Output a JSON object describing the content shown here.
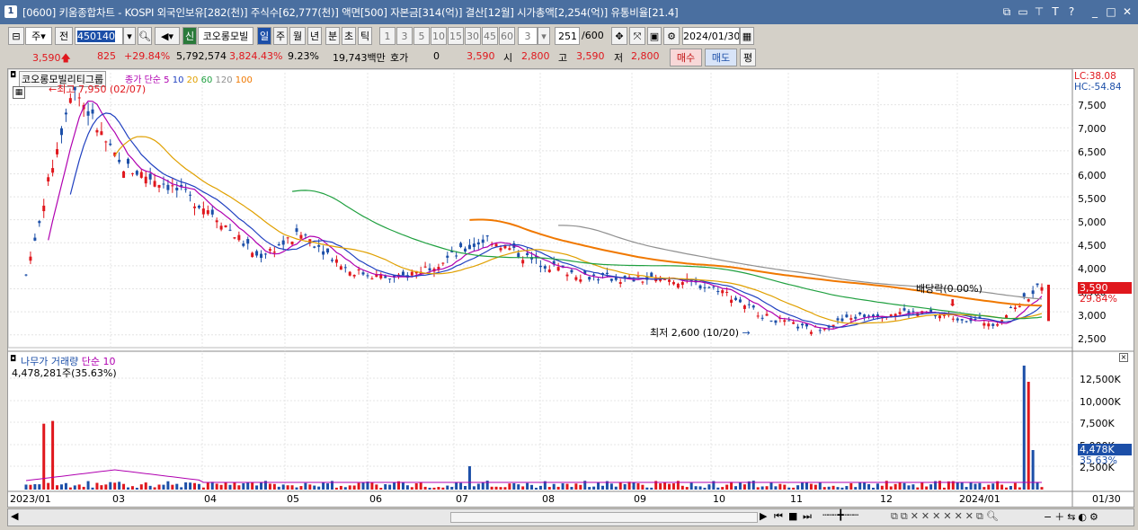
{
  "window": {
    "title": "[0600] 키움종합차트 - KOSPI 외국인보유[282(천)] 주식수[62,777(천)] 액면[500] 자본금[314(억)] 결산[12월] 시가총액[2,254(억)] 유통비율[21.4]",
    "app_icon": "1"
  },
  "toolbar": {
    "period_label": "주",
    "prev_label": "전",
    "code_value": "450140",
    "new_badge": "신",
    "stock_name": "코오롱모빌",
    "tabs": [
      "일",
      "주",
      "월",
      "년",
      "분",
      "초",
      "틱"
    ],
    "active_tab": "일",
    "minute_opts": [
      "1",
      "3",
      "5",
      "10",
      "15",
      "30",
      "45",
      "60"
    ],
    "tick_value": "3",
    "count_value": "251",
    "count_max": "/600",
    "date_value": "2024/01/30"
  },
  "quote": {
    "price": "3,590",
    "change": "825",
    "change_pct": "+29.84%",
    "volume": "5,792,574",
    "volume_pct": "3,824.43%",
    "turnover": "9.23%",
    "amount": "19,743백만",
    "hoga_label": "호가",
    "hoga_value": "0",
    "hoga_price": "3,590",
    "open_label": "시",
    "open": "2,800",
    "high_label": "고",
    "high": "3,590",
    "low_label": "저",
    "low": "2,800",
    "buy_label": "매수",
    "sell_label": "매도",
    "eval_label": "평"
  },
  "price_panel": {
    "stock_label": "코오롱모빌리티그룹",
    "ma_label": "종가 단순",
    "ma_periods": [
      "5",
      "10",
      "20",
      "60",
      "120",
      "100"
    ],
    "high_note": "최고 7,950 (02/07)",
    "low_note": "최저 2,600 (10/20)",
    "dividend_note": "배당락(0.00%)",
    "lc": "LC:38.08",
    "hc": "HC:-54.84",
    "y_ticks": [
      "7,500",
      "7,000",
      "6,500",
      "6,000",
      "5,500",
      "5,000",
      "4,500",
      "4,000",
      "3,500",
      "3,000",
      "2,500"
    ],
    "price_tag": "3,590",
    "pct_tag": "29.84%"
  },
  "volume_panel": {
    "label": "나무가 거래량",
    "ma_label": "단순 10",
    "value": "4,478,281주(35.63%)",
    "y_ticks": [
      "12,500K",
      "10,000K",
      "7,500K",
      "5,000K",
      "2,500K"
    ],
    "volume_tag": "4,478K",
    "pct_tag": "35.63%"
  },
  "x_axis": {
    "labels": [
      "2023/01",
      "03",
      "04",
      "05",
      "06",
      "07",
      "08",
      "09",
      "10",
      "11",
      "12",
      "2024/01"
    ],
    "right_label": "01/30"
  },
  "colors": {
    "up": "#e0171d",
    "down": "#1c4fa8",
    "ma5": "#b000b0",
    "ma10": "#2040c0",
    "ma20": "#e0a000",
    "ma60": "#20a040",
    "ma120": "#909090",
    "ma100": "#f07800"
  },
  "chart_data": {
    "type": "candlestick",
    "series_desc": "weekly-ish daily price for 코오롱모빌리티그룹, 2023/01–2024/01",
    "close_points": [
      {
        "x": "2023/01",
        "y": 3800
      },
      {
        "x": "2023/02",
        "y": 7950
      },
      {
        "x": "2023/02b",
        "y": 6200
      },
      {
        "x": "2023/03",
        "y": 5800
      },
      {
        "x": "2023/03b",
        "y": 5200
      },
      {
        "x": "2023/04",
        "y": 4200
      },
      {
        "x": "2023/04b",
        "y": 4700
      },
      {
        "x": "2023/05",
        "y": 3900
      },
      {
        "x": "2023/05b",
        "y": 3700
      },
      {
        "x": "2023/06",
        "y": 4100
      },
      {
        "x": "2023/06b",
        "y": 4600
      },
      {
        "x": "2023/07",
        "y": 4100
      },
      {
        "x": "2023/07b",
        "y": 3800
      },
      {
        "x": "2023/08",
        "y": 3700
      },
      {
        "x": "2023/09",
        "y": 3700
      },
      {
        "x": "2023/09b",
        "y": 3500
      },
      {
        "x": "2023/10",
        "y": 2900
      },
      {
        "x": "2023/10b",
        "y": 2600
      },
      {
        "x": "2023/11",
        "y": 2900
      },
      {
        "x": "2023/12",
        "y": 3000
      },
      {
        "x": "2024/01",
        "y": 2900
      },
      {
        "x": "2024/01b",
        "y": 2750
      },
      {
        "x": "2024/01/30",
        "y": 3590
      }
    ],
    "ylim": [
      2300,
      8000
    ]
  }
}
